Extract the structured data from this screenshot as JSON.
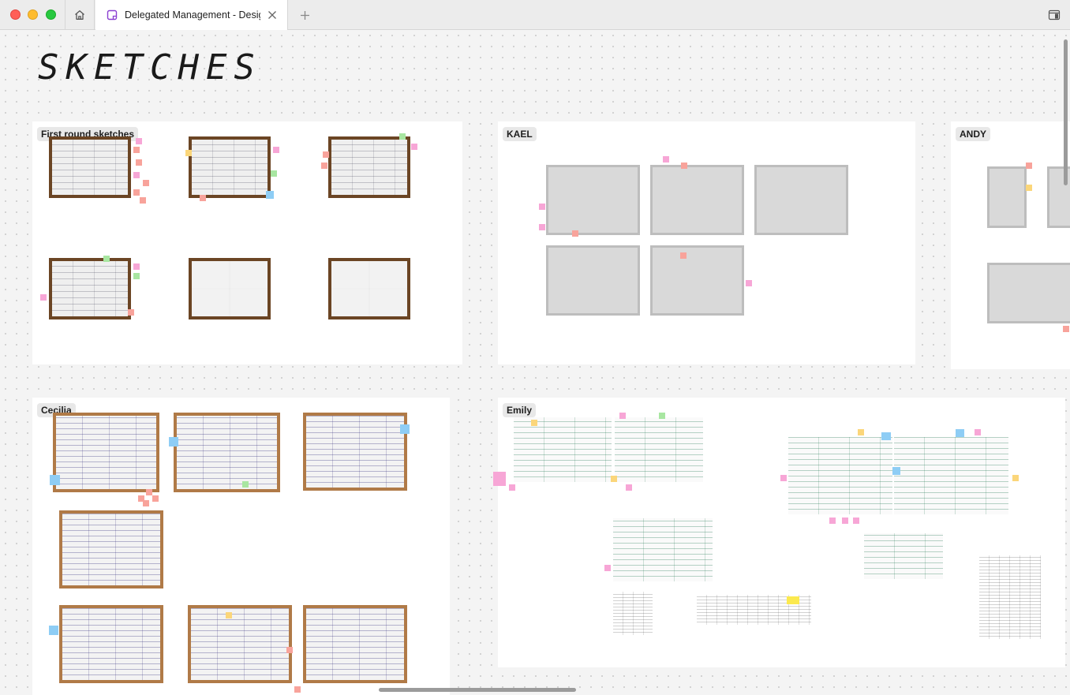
{
  "window": {
    "tab_title": "Delegated Management - Design",
    "icons": [
      "home-icon",
      "figjam-file-icon",
      "close-icon",
      "plus-icon",
      "sidebar-icon"
    ]
  },
  "board": {
    "title": "SKETCHES"
  },
  "sections": {
    "first_round": "First round sketches",
    "kael": "KAEL",
    "andy": "ANDY",
    "cecilia": "Cecilia",
    "emily": "Emily"
  },
  "colors": {
    "canvas": "#f4f4f4",
    "sticky_pink": "#f7a6d6",
    "sticky_salmon": "#f8a39b",
    "sticky_green": "#a8e6a1",
    "sticky_blue": "#8ecdf5",
    "sticky_yellow": "#fbd67a"
  }
}
